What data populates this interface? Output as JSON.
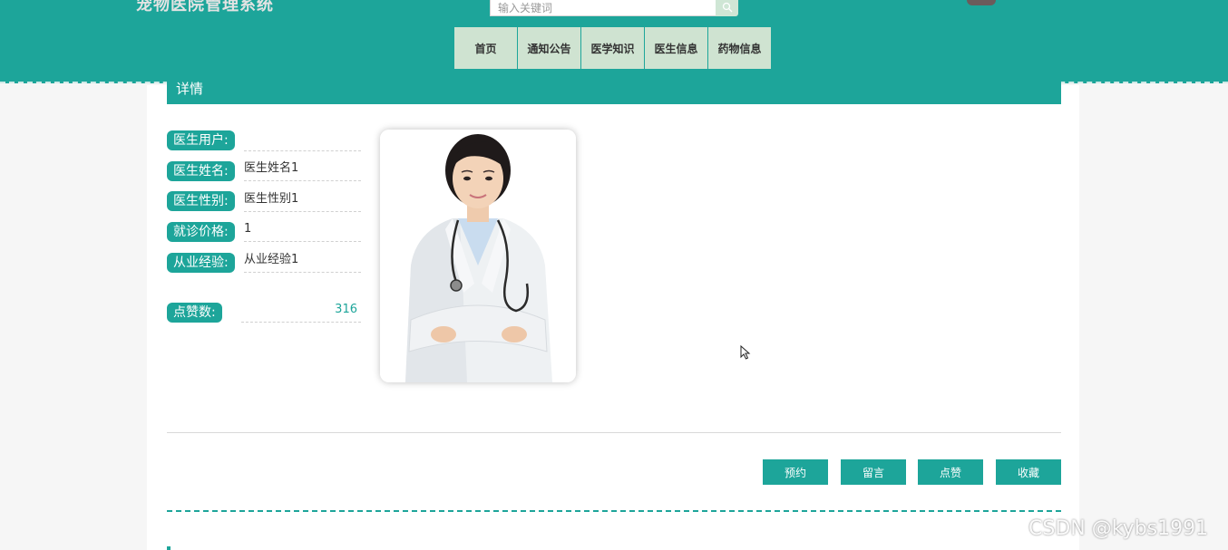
{
  "header": {
    "site_title": "宠物医院管理系统",
    "search": {
      "placeholder": "输入关键词"
    },
    "nav": [
      "首页",
      "通知公告",
      "医学知识",
      "医生信息",
      "药物信息"
    ]
  },
  "detail": {
    "section_title": "详情",
    "fields": [
      {
        "label": "医生用户:",
        "value": ""
      },
      {
        "label": "医生姓名:",
        "value": "医生姓名1"
      },
      {
        "label": "医生性别:",
        "value": "医生性别1"
      },
      {
        "label": "就诊价格:",
        "value": "1"
      },
      {
        "label": "从业经验:",
        "value": "从业经验1"
      }
    ],
    "likes": {
      "label": "点赞数:",
      "value": "316"
    }
  },
  "actions": [
    "预约",
    "留言",
    "点赞",
    "收藏"
  ],
  "watermark": "CSDN @kybs1991",
  "colors": {
    "primary": "#1da59a",
    "nav_bg": "#cfe3d1"
  }
}
